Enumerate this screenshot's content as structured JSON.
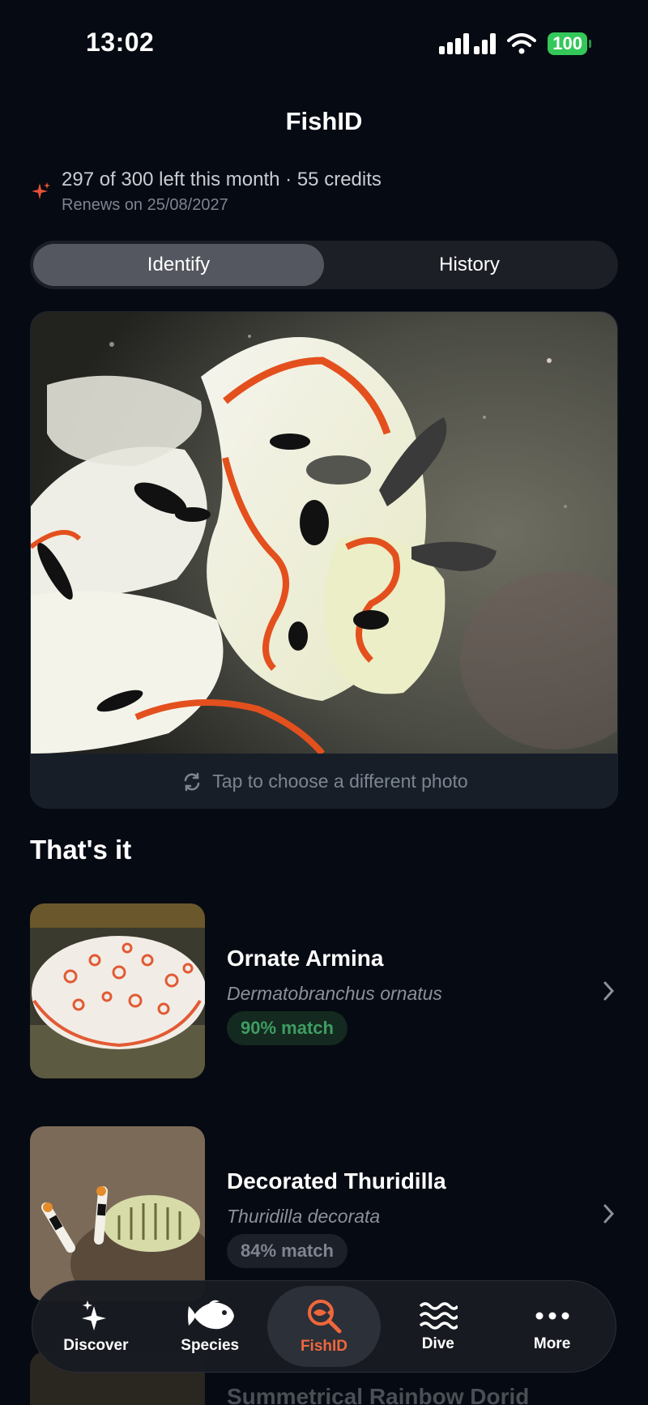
{
  "status": {
    "time": "13:02",
    "battery": "100"
  },
  "header": {
    "title": "FishID"
  },
  "quota": {
    "main": "297 of 300 left this month · 55 credits",
    "renews": "Renews on 25/08/2027"
  },
  "tabs": [
    {
      "label": "Identify",
      "active": true
    },
    {
      "label": "History",
      "active": false
    }
  ],
  "photo": {
    "change_label": "Tap to choose a different photo"
  },
  "results_section": {
    "title": "That's it"
  },
  "results": [
    {
      "name": "Ornate Armina",
      "scientific": "Dermatobranchus ornatus",
      "match": "90% match",
      "match_color": "#3e9d62"
    },
    {
      "name": "Decorated Thuridilla",
      "scientific": "Thuridilla decorata",
      "match": "84% match",
      "match_color": "#7f8590"
    },
    {
      "name": "Summetrical Rainbow Dorid"
    }
  ],
  "nav": [
    {
      "label": "Discover",
      "icon": "sparkles-icon"
    },
    {
      "label": "Species",
      "icon": "fish-icon"
    },
    {
      "label": "FishID",
      "icon": "fish-search-icon",
      "active": true
    },
    {
      "label": "Dive",
      "icon": "waves-icon"
    },
    {
      "label": "More",
      "icon": "more-icon"
    }
  ],
  "colors": {
    "accent": "#f0673c",
    "background": "#060a12",
    "match_green": "#3e9d62"
  }
}
